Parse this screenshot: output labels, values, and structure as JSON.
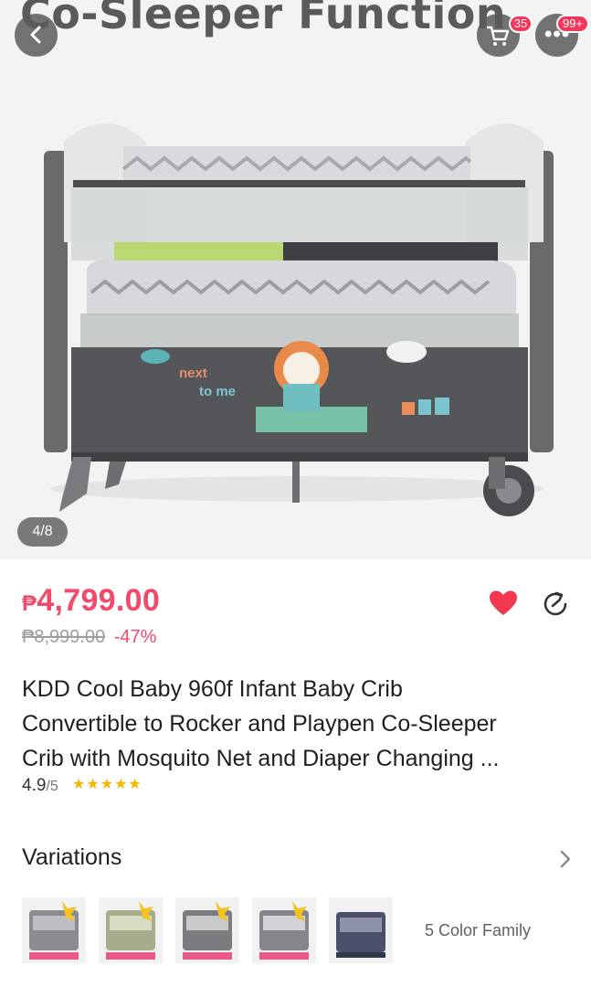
{
  "gallery": {
    "heading": "Co-Sleeper Function",
    "cart_badge": "35",
    "more_badge": "99+",
    "image_counter": "4/8",
    "image_text_line1": "next",
    "image_text_line2": "to me",
    "icons": {
      "back": "chevron-left-icon",
      "cart": "cart-icon",
      "more": "more-dots-icon"
    }
  },
  "product": {
    "currency": "₱",
    "price": "4,799.00",
    "original_price": "₱8,999.00",
    "discount": "-47%",
    "title_lines": [
      "KDD Cool Baby 960f Infant Baby Crib",
      "Convertible to Rocker and Playpen Co-Sleeper",
      "Crib with Mosquito Net and Diaper Changing ..."
    ],
    "rating": "4.9",
    "rating_max": "/5",
    "stars": 5,
    "stars_text": "★★★★★",
    "icons": {
      "wishlist": "heart-icon",
      "share": "share-icon"
    }
  },
  "variations": {
    "label": "Variations",
    "thumb_count": 5,
    "color_family": "5 Color Family"
  },
  "colors": {
    "accent": "#f24a6b",
    "star": "#f8b500",
    "frame": "#5b5b5e"
  }
}
